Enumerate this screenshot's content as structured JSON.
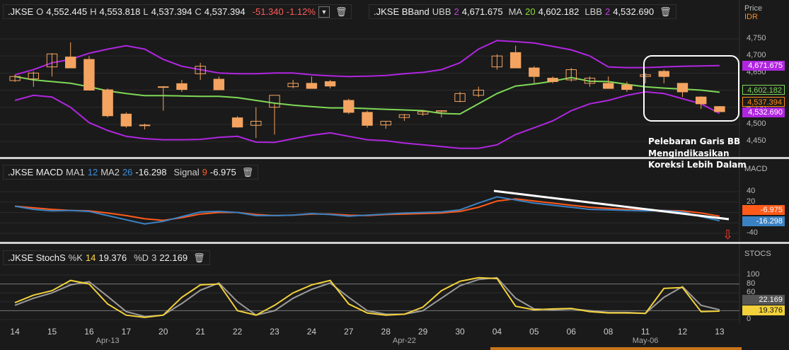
{
  "symbol": ".JKSE",
  "ohlc": {
    "open_label": "O",
    "open": "4,552.445",
    "high_label": "H",
    "high": "4,553.818",
    "low_label": "L",
    "low": "4,537.394",
    "close_label": "C",
    "close": "4,537.394",
    "change": "-51.340",
    "change_pct": "-1.12%"
  },
  "bband": {
    "title": ".JKSE BBand",
    "ubb_label": "UBB",
    "ubb_period": "2",
    "ubb_value": "4,671.675",
    "ma_label": "MA",
    "ma_period": "20",
    "ma_value": "4,602.182",
    "lbb_label": "LBB",
    "lbb_period": "2",
    "lbb_value": "4,532.690"
  },
  "macd": {
    "title": ".JKSE MACD",
    "ma1_label": "MA1",
    "ma1_period": "12",
    "ma2_label": "MA2",
    "ma2_period": "26",
    "macd_value": "-16.298",
    "signal_label": "Signal",
    "signal_period": "9",
    "signal_value": "-6.975"
  },
  "stoch": {
    "title": ".JKSE StochS",
    "k_label": "%K",
    "k_period": "14",
    "k_value": "19.376",
    "d_label": "%D",
    "d_period": "3",
    "d_value": "22.169"
  },
  "price_axis": {
    "header1": "Price",
    "header2": "IDR",
    "ticks": [
      "4,750",
      "4,700",
      "4,650",
      "4,600",
      "4,550",
      "4,500",
      "4,450"
    ]
  },
  "macd_axis": {
    "name": "MACD",
    "ticks": [
      "40",
      "20",
      "0",
      "-20",
      "-40"
    ]
  },
  "stoch_axis": {
    "name": "STOCS",
    "ticks": [
      "100",
      "80",
      "60",
      "40",
      "20",
      "0"
    ]
  },
  "tags": {
    "ubb": "4,671.675",
    "ma": "4,602.182",
    "close": "4,537.394",
    "lbb": "4,532.690",
    "signal": "-6.975",
    "macd": "-16.298",
    "d": "22.169",
    "k": "19.376"
  },
  "x_axis": {
    "days": [
      "14",
      "15",
      "16",
      "17",
      "20",
      "21",
      "22",
      "23",
      "24",
      "27",
      "28",
      "29",
      "30",
      "04",
      "05",
      "06",
      "08",
      "11",
      "12",
      "13"
    ],
    "months": [
      "Apr-13",
      "Apr-22",
      "May-06"
    ]
  },
  "annotation": {
    "line1": "Pelebaran Garis BB",
    "line2": "Mengindikasikan",
    "line3": "Koreksi Lebih Dalam"
  },
  "icons": {
    "dropdown": "chevron-down-icon",
    "trash": "trash-icon",
    "arrow": "down-arrow-icon"
  },
  "colors": {
    "background": "#1a1a1a",
    "candle": "#f4a460",
    "bb_bands": "#b026e0",
    "ma20": "#7ed957",
    "macd": "#3b82c4",
    "signal": "#ff5a1a",
    "stoch_k": "#f2d13a",
    "stoch_d": "#9a9a9a",
    "negative": "#ff5a5a"
  },
  "chart_data": [
    {
      "type": "candlestick",
      "title": ".JKSE BBand",
      "ylabel": "Price IDR",
      "ylim": [
        4430,
        4775
      ],
      "x": [
        "14",
        "",
        "15",
        "",
        "16",
        "",
        "17",
        "",
        "20",
        "",
        "21",
        "",
        "22",
        "",
        "23",
        "",
        "24",
        "",
        "27",
        "",
        "28",
        "",
        "29",
        "",
        "30",
        "",
        "04",
        "",
        "05",
        "",
        "06",
        "",
        "08",
        "",
        "11",
        "",
        "12",
        "",
        "13"
      ],
      "open": [
        4628,
        4633,
        4668,
        4697,
        4690,
        4601,
        4530,
        4498,
        4608,
        4619,
        4648,
        4632,
        4519,
        4497,
        4550,
        4610,
        4620,
        4625,
        4570,
        4535,
        4498,
        4520,
        4530,
        4537,
        4567,
        4585,
        4668,
        4710,
        4665,
        4635,
        4630,
        4620,
        4620,
        4615,
        4640,
        4655,
        4620,
        4580,
        4552
      ],
      "high": [
        4645,
        4655,
        4708,
        4740,
        4700,
        4605,
        4535,
        4502,
        4612,
        4630,
        4680,
        4640,
        4524,
        4550,
        4560,
        4630,
        4640,
        4630,
        4575,
        4540,
        4510,
        4530,
        4540,
        4540,
        4595,
        4610,
        4705,
        4730,
        4670,
        4640,
        4665,
        4640,
        4640,
        4625,
        4650,
        4660,
        4620,
        4582,
        4553
      ],
      "low": [
        4624,
        4610,
        4640,
        4675,
        4600,
        4520,
        4490,
        4485,
        4540,
        4595,
        4630,
        4600,
        4490,
        4460,
        4470,
        4605,
        4610,
        4605,
        4530,
        4490,
        4487,
        4510,
        4525,
        4520,
        4565,
        4580,
        4660,
        4690,
        4620,
        4620,
        4625,
        4610,
        4610,
        4595,
        4620,
        4620,
        4580,
        4545,
        4537
      ],
      "close": [
        4640,
        4650,
        4706,
        4665,
        4600,
        4525,
        4495,
        4496,
        4610,
        4602,
        4670,
        4601,
        4492,
        4509,
        4585,
        4620,
        4605,
        4612,
        4535,
        4497,
        4509,
        4528,
        4537,
        4540,
        4590,
        4600,
        4700,
        4665,
        4640,
        4625,
        4660,
        4635,
        4605,
        4602,
        4645,
        4640,
        4595,
        4560,
        4537
      ],
      "series": [
        {
          "name": "UBB",
          "values": [
            4645,
            4660,
            4680,
            4690,
            4708,
            4720,
            4730,
            4720,
            4690,
            4670,
            4660,
            4650,
            4648,
            4648,
            4650,
            4650,
            4645,
            4642,
            4640,
            4641,
            4643,
            4648,
            4652,
            4660,
            4680,
            4720,
            4745,
            4742,
            4738,
            4728,
            4718,
            4700,
            4668,
            4666,
            4666,
            4668,
            4670,
            4671,
            4672
          ]
        },
        {
          "name": "MA20",
          "values": [
            4640,
            4630,
            4625,
            4620,
            4610,
            4598,
            4590,
            4584,
            4584,
            4583,
            4582,
            4582,
            4578,
            4570,
            4562,
            4556,
            4552,
            4548,
            4548,
            4546,
            4544,
            4542,
            4540,
            4532,
            4530,
            4560,
            4590,
            4612,
            4618,
            4626,
            4637,
            4626,
            4625,
            4617,
            4610,
            4606,
            4603,
            4600,
            4594
          ]
        },
        {
          "name": "LBB",
          "values": [
            4570,
            4585,
            4580,
            4550,
            4505,
            4482,
            4465,
            4458,
            4455,
            4455,
            4456,
            4462,
            4465,
            4448,
            4447,
            4458,
            4468,
            4475,
            4465,
            4455,
            4452,
            4445,
            4440,
            4435,
            4430,
            4430,
            4440,
            4470,
            4490,
            4510,
            4540,
            4560,
            4570,
            4585,
            4595,
            4590,
            4575,
            4560,
            4532
          ]
        }
      ]
    },
    {
      "type": "line",
      "title": ".JKSE MACD",
      "ylim": [
        -50,
        55
      ],
      "series": [
        {
          "name": "MACD",
          "values": [
            12,
            6,
            3,
            4,
            2,
            -6,
            -14,
            -22,
            -17,
            -8,
            1,
            2,
            0,
            -6,
            -6,
            -5,
            -2,
            -4,
            -7,
            -5,
            -3,
            -1,
            0,
            1,
            5,
            18,
            30,
            24,
            18,
            14,
            10,
            6,
            5,
            4,
            3,
            4,
            1,
            -8,
            -16
          ]
        },
        {
          "name": "Signal",
          "values": [
            12,
            9,
            6,
            4,
            3,
            -1,
            -6,
            -12,
            -15,
            -10,
            -3,
            0,
            0,
            -4,
            -6,
            -5,
            -3,
            -3,
            -5,
            -6,
            -4,
            -3,
            -2,
            -1,
            2,
            10,
            22,
            26,
            22,
            18,
            14,
            10,
            8,
            6,
            4,
            4,
            3,
            -1,
            -7
          ]
        }
      ]
    },
    {
      "type": "line",
      "title": ".JKSE StochS",
      "ylim": [
        0,
        100
      ],
      "series": [
        {
          "name": "%K",
          "values": [
            38,
            55,
            65,
            88,
            80,
            35,
            10,
            5,
            10,
            50,
            78,
            80,
            20,
            10,
            32,
            60,
            78,
            88,
            35,
            15,
            10,
            12,
            28,
            65,
            86,
            94,
            92,
            30,
            22,
            24,
            25,
            18,
            15,
            15,
            14,
            70,
            72,
            18,
            19
          ]
        },
        {
          "name": "%D",
          "values": [
            32,
            48,
            60,
            78,
            85,
            52,
            18,
            7,
            10,
            36,
            66,
            82,
            40,
            10,
            20,
            48,
            68,
            82,
            50,
            20,
            12,
            12,
            20,
            48,
            76,
            90,
            94,
            48,
            24,
            22,
            24,
            20,
            16,
            16,
            14,
            50,
            74,
            32,
            22
          ]
        }
      ]
    }
  ]
}
